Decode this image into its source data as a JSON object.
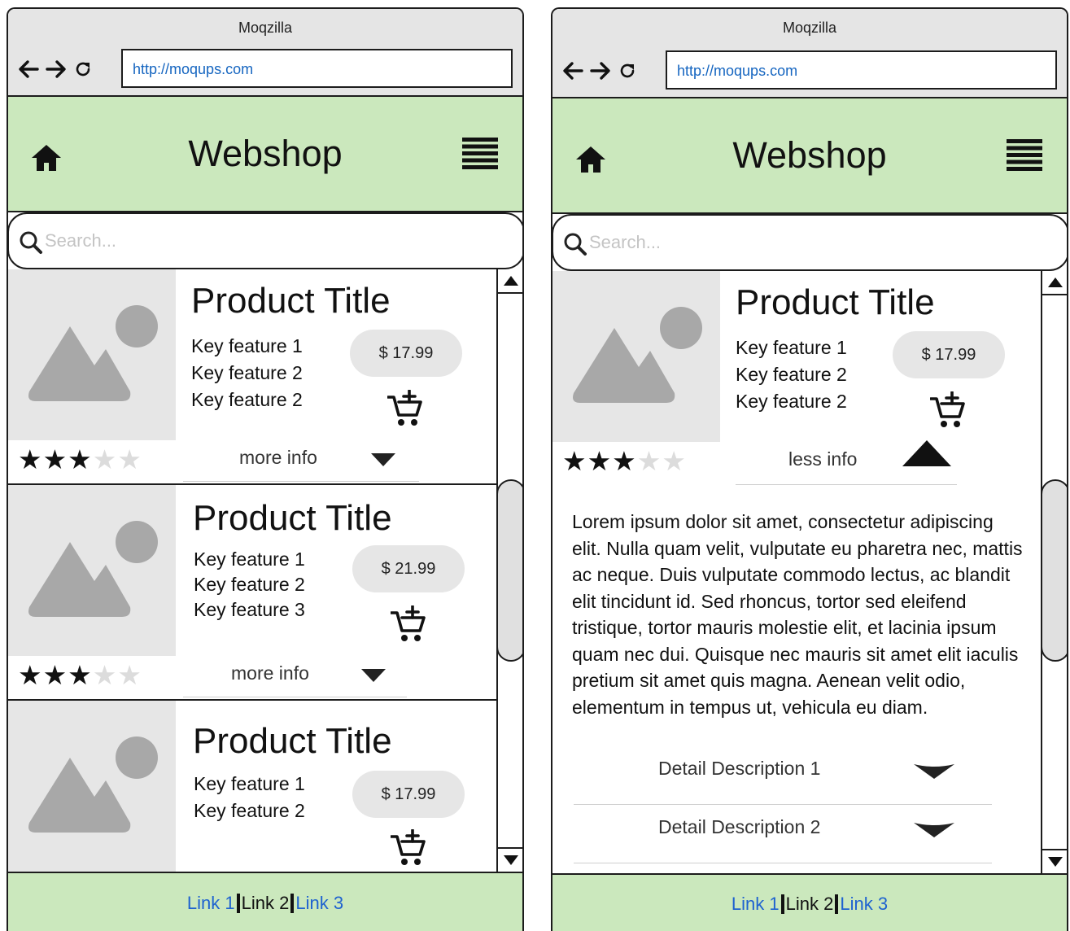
{
  "browser": {
    "window_title": "Moqzilla",
    "url": "http://moqups.com"
  },
  "header": {
    "title": "Webshop"
  },
  "search": {
    "placeholder": "Search..."
  },
  "icons": {
    "back": "back-arrow-icon",
    "forward": "forward-arrow-icon",
    "reload": "reload-icon",
    "home": "home-icon",
    "menu": "hamburger-menu-icon",
    "search": "search-icon",
    "cart": "add-to-cart-icon",
    "image": "image-placeholder-icon",
    "expand": "caret-down-icon",
    "collapse": "caret-up-icon"
  },
  "colors": {
    "header_bg": "#cbe8bd",
    "chrome_bg": "#e5e5e5",
    "link": "#1e62d0",
    "price_pill": "#e6e6e6"
  },
  "left_screen": {
    "products": [
      {
        "title": "Product Title",
        "features": [
          "Key feature 1",
          "Key feature 2",
          "Key feature 2"
        ],
        "price": "$ 17.99",
        "rating": 3,
        "rating_max": 5,
        "info_label": "more info"
      },
      {
        "title": "Product Title",
        "features": [
          "Key feature 1",
          "Key feature 2",
          "Key feature 3"
        ],
        "price": "$ 21.99",
        "rating": 3,
        "rating_max": 5,
        "info_label": "more info"
      },
      {
        "title": "Product Title",
        "features": [
          "Key feature 1",
          "Key feature 2"
        ],
        "price": "$ 17.99"
      }
    ]
  },
  "right_screen": {
    "product": {
      "title": "Product Title",
      "features": [
        "Key feature 1",
        "Key feature 2",
        "Key feature 2"
      ],
      "price": "$ 17.99",
      "rating": 3,
      "rating_max": 5,
      "info_label": "less info",
      "description": "Lorem ipsum dolor sit amet, consectetur adipiscing elit. Nulla quam velit, vulputate eu pharetra nec, mattis ac neque. Duis vulputate commodo lectus, ac blandit elit tincidunt id. Sed rhoncus, tortor sed eleifend tristique, tortor mauris molestie elit, et lacinia ipsum quam nec dui. Quisque nec mauris sit amet elit iaculis pretium sit amet quis magna. Aenean velit odio, elementum in tempus ut, vehicula eu diam.",
      "details": [
        "Detail Description 1",
        "Detail Description 2"
      ]
    }
  },
  "footer": {
    "link1": "Link 1",
    "link2": "Link 2",
    "link3": "Link 3"
  }
}
